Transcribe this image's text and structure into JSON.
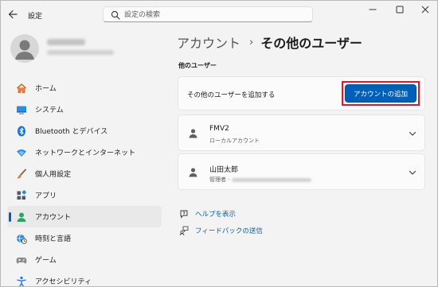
{
  "window": {
    "title": "設定"
  },
  "search": {
    "placeholder": "設定の検索"
  },
  "nav": {
    "items": [
      {
        "label": "ホーム",
        "icon": "home-icon"
      },
      {
        "label": "システム",
        "icon": "monitor-icon"
      },
      {
        "label": "Bluetooth とデバイス",
        "icon": "bluetooth-icon"
      },
      {
        "label": "ネットワークとインターネット",
        "icon": "wifi-icon"
      },
      {
        "label": "個人用設定",
        "icon": "brush-icon"
      },
      {
        "label": "アプリ",
        "icon": "apps-icon"
      },
      {
        "label": "アカウント",
        "icon": "account-icon",
        "active": true
      },
      {
        "label": "時刻と言語",
        "icon": "globe-clock-icon"
      },
      {
        "label": "ゲーム",
        "icon": "gamepad-icon"
      },
      {
        "label": "アクセシビリティ",
        "icon": "accessibility-icon"
      }
    ]
  },
  "breadcrumb": {
    "parent": "アカウント",
    "separator": "›",
    "current": "その他のユーザー"
  },
  "section": {
    "title": "他のユーザー"
  },
  "add_card": {
    "text": "その他のユーザーを追加する",
    "button_label": "アカウントの追加"
  },
  "users": [
    {
      "name": "FMV2",
      "subtitle": "ローカルアカウント"
    },
    {
      "name": "山田太郎",
      "subtitle": "管理者 ·"
    }
  ],
  "links": {
    "help": "ヘルプを表示",
    "feedback": "フィードバックの送信"
  },
  "colors": {
    "accent": "#005fb8",
    "highlight": "#e8112d",
    "background": "#f3f3f3",
    "card": "#fbfbfb"
  }
}
